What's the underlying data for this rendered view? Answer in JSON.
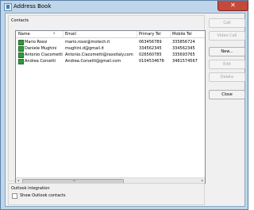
{
  "window": {
    "title": "Address Book",
    "close_glyph": "✕"
  },
  "contacts": {
    "group_label": "Contacts",
    "columns": [
      "Name",
      "Email",
      "Primary Tel",
      "Mobile Tel"
    ],
    "rows": [
      {
        "name": "Mario Rossi",
        "email": "mario.rossi@motech.it",
        "primary": "063456789",
        "mobile": "335856724"
      },
      {
        "name": "Daniele Mughini",
        "email": "mughini.d@gmail.it",
        "primary": "334562345",
        "mobile": "334562345"
      },
      {
        "name": "Antonio Ciacometti",
        "email": "Antonio.Ciacometti@raxsitaly.com",
        "primary": "026560785",
        "mobile": "335693765"
      },
      {
        "name": "Andrea Corsetti",
        "email": "Andrea.Corsetti@gmail.com",
        "primary": "0104534678",
        "mobile": "3481574567"
      }
    ]
  },
  "outlook": {
    "group_label": "Outlook integration",
    "checkbox_label": "Show Outlook contacts"
  },
  "buttons": {
    "call": "Call",
    "video_call": "Video Call",
    "new": "New...",
    "edit": "Edit",
    "delete": "Delete",
    "close": "Close"
  },
  "scroll": {
    "left": "◂",
    "right": "▸",
    "grip": "III"
  }
}
